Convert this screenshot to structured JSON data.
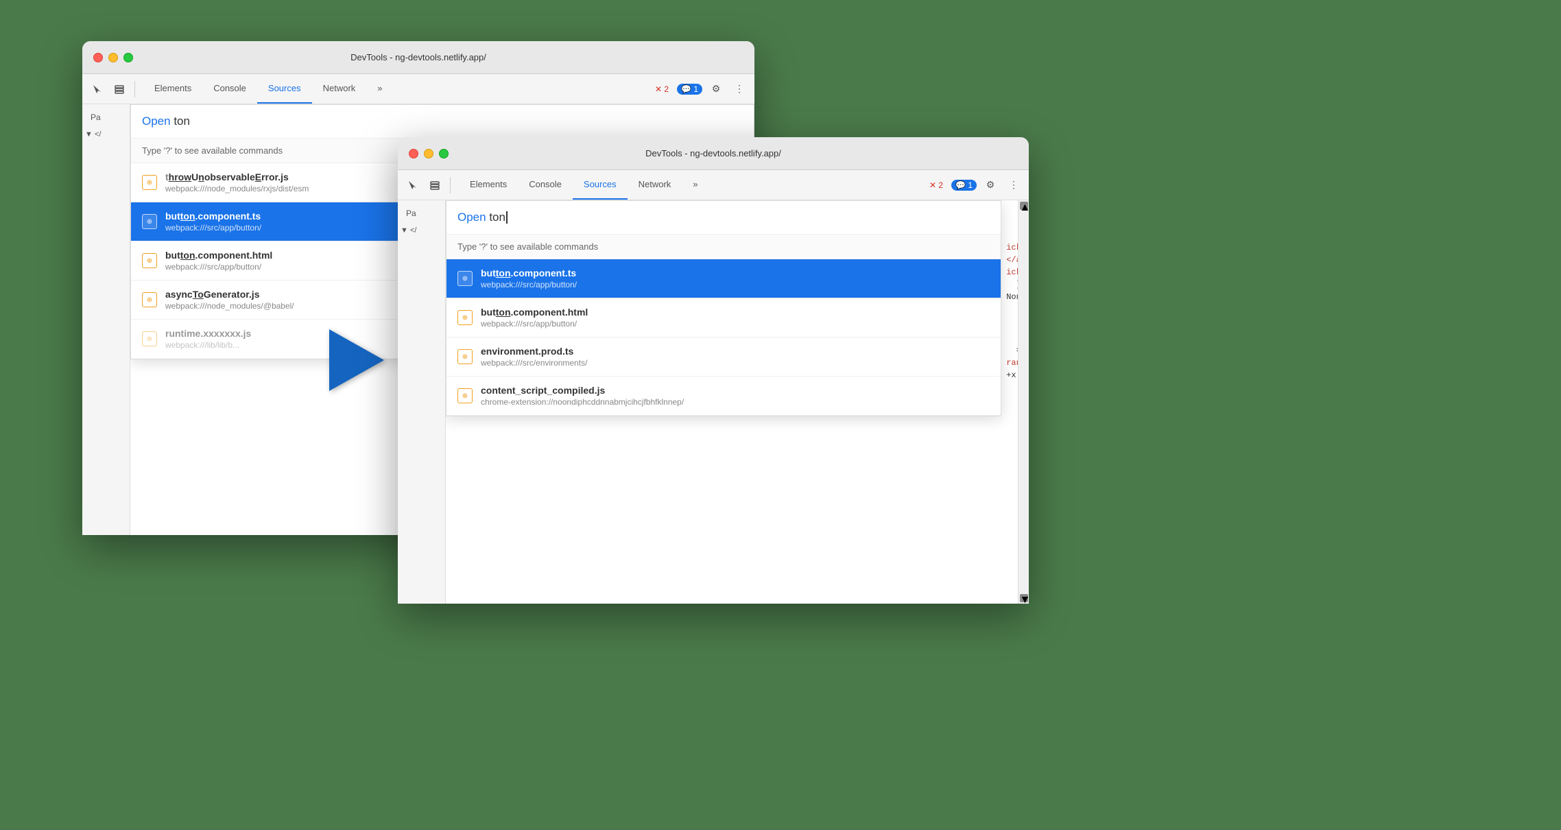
{
  "window_back": {
    "titlebar": {
      "title": "DevTools - ng-devtools.netlify.app/"
    },
    "toolbar": {
      "tabs": [
        {
          "label": "Elements",
          "active": false
        },
        {
          "label": "Console",
          "active": false
        },
        {
          "label": "Sources",
          "active": true
        },
        {
          "label": "Network",
          "active": false
        },
        {
          "label": "»",
          "active": false
        }
      ],
      "errors": "✕ 2",
      "messages": "💬 1"
    },
    "sidebar": {
      "label": "Pa"
    },
    "command_palette": {
      "open_label": "Open",
      "query": " ton",
      "hint": "Type '?' to see available commands",
      "results": [
        {
          "id": "r1",
          "filename": "throwUnobservableError.js",
          "highlight_chars": "ton",
          "path": "webpack:///node_modules/rxjs/dist/esm",
          "selected": false
        },
        {
          "id": "r2",
          "filename": "button.component.ts",
          "highlight_chars": "ton",
          "path": "webpack:///src/app/button/",
          "selected": true
        },
        {
          "id": "r3",
          "filename": "button.component.html",
          "highlight_chars": "ton",
          "path": "webpack:///src/app/button/",
          "selected": false
        },
        {
          "id": "r4",
          "filename": "asyncToGenerator.js",
          "highlight_chars": "To",
          "path": "webpack:///node_modules/@babel/",
          "selected": false
        }
      ]
    }
  },
  "window_front": {
    "titlebar": {
      "title": "DevTools - ng-devtools.netlify.app/"
    },
    "toolbar": {
      "tabs": [
        {
          "label": "Elements",
          "active": false
        },
        {
          "label": "Console",
          "active": false
        },
        {
          "label": "Sources",
          "active": true
        },
        {
          "label": "Network",
          "active": false
        },
        {
          "label": "»",
          "active": false
        }
      ],
      "errors": "✕ 2",
      "messages": "💬 1"
    },
    "sidebar": {
      "label": "Pa"
    },
    "command_palette": {
      "open_label": "Open",
      "query": "ton",
      "hint": "Type '?' to see available commands",
      "results": [
        {
          "id": "f1",
          "filename": "button.component.ts",
          "highlight_chars": "ton",
          "path": "webpack:///src/app/button/",
          "selected": true
        },
        {
          "id": "f2",
          "filename": "button.component.html",
          "highlight_chars": "ton",
          "path": "webpack:///src/app/button/",
          "selected": false
        },
        {
          "id": "f3",
          "filename": "environment.prod.ts",
          "highlight_chars": "",
          "path": "webpack:///src/environments/",
          "selected": false
        },
        {
          "id": "f4",
          "filename": "content_script_compiled.js",
          "highlight_chars": "",
          "path": "chrome-extension://noondiphcddnnabmjcihcjfbhfklnnep/",
          "selected": false
        }
      ]
    },
    "code_snippets": [
      {
        "text": "ick)",
        "color": "red"
      },
      {
        "text": "</ap",
        "color": "red"
      },
      {
        "text": "ick)",
        "color": "red"
      },
      {
        "text": "],",
        "color": "normal"
      },
      {
        "text": "None",
        "color": "normal"
      },
      {
        "text": "=>",
        "color": "normal"
      },
      {
        "text": "rand",
        "color": "red"
      },
      {
        "text": "+x |",
        "color": "normal"
      }
    ]
  }
}
